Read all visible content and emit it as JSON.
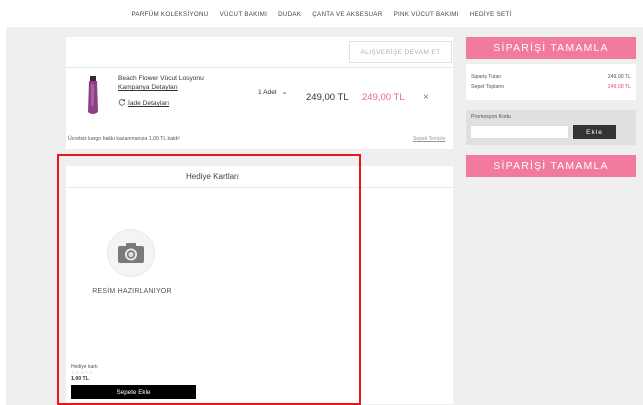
{
  "nav": [
    "PARFÜM KOLEKSİYONU",
    "VÜCUT BAKIMI",
    "DUDAK",
    "ÇANTA VE AKSESUAR",
    "PINK VÜCUT BAKIMI",
    "HEDİYE SETİ"
  ],
  "cart": {
    "continue_label": "ALIŞVERİŞE DEVAM ET",
    "product_name": "Beach Flower Vücut Losyonu",
    "campaign_link": "Kampanya Detayları",
    "return_link": "İade Detayları",
    "quantity": "1 Adet",
    "price": "249,00 TL",
    "discounted_price": "249,00 TL",
    "remove": "×",
    "shipping_note": "Ücretsiz kargo hakkı kazanmanıza 1.00 TL kaldı!",
    "clear_cart": "Sepeti Temizle"
  },
  "gift": {
    "title": "Hediye Kartları",
    "no_image": "RESİM HAZIRLANIYOR",
    "item_name": "Hediye kartı",
    "stars": "☆☆☆☆☆",
    "price": "1.00 TL",
    "add_label": "Sepete Ekle"
  },
  "summary": {
    "complete_label": "SİPARİŞİ TAMAMLA",
    "order_total_label": "Sipariş Tutarı",
    "order_total": "249,00 TL",
    "cart_total_label": "Sepet Toplamı",
    "cart_total": "249,00 TL",
    "promo_label": "Promosyon Kodu",
    "promo_placeholder": "",
    "promo_button": "Ekle"
  },
  "colors": {
    "accent": "#f27a9c",
    "price_pink": "#e5638d",
    "highlight": "#e8171b"
  }
}
